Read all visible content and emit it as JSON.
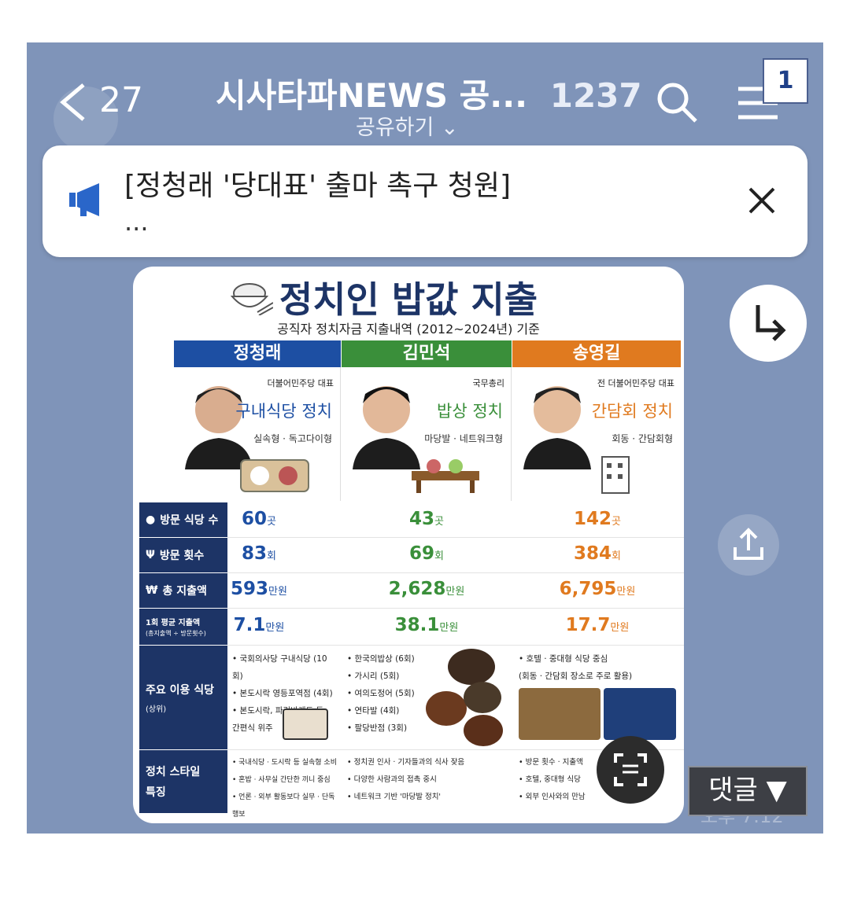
{
  "header": {
    "back_count": "27",
    "chat_title": "시사타파NEWS 공...",
    "member_count": "1237",
    "share_label": "공유하기",
    "badge": "1"
  },
  "notice": {
    "text": "[정청래 '당대표' 출마 촉구 청원]",
    "more": "..."
  },
  "infographic": {
    "title": "정치인 밥값 지출",
    "subtitle": "공직자 정치자금 지출내역 (2012~2024년) 기준",
    "columns": [
      {
        "name": "정청래",
        "party": "더불어민주당 대표",
        "style": "구내식당 정치",
        "type": "실속형 · 독고다이형",
        "color": "#1d4fa3"
      },
      {
        "name": "김민석",
        "party": "국무총리",
        "style": "밥상 정치",
        "type": "마당발 · 네트워크형",
        "color": "#3a8f3a"
      },
      {
        "name": "송영길",
        "party": "전 더불어민주당 대표",
        "style": "간담회 정치",
        "type": "회동 · 간담회형",
        "color": "#e07a1f"
      }
    ],
    "rows": [
      {
        "label": "방문 식당 수",
        "values": [
          "60",
          "43",
          "142"
        ],
        "unit": "곳"
      },
      {
        "label": "방문 횟수",
        "values": [
          "83",
          "69",
          "384"
        ],
        "unit": "회"
      },
      {
        "label": "총 지출액",
        "values": [
          "593",
          "2,628",
          "6,795"
        ],
        "unit": "만원"
      },
      {
        "label": "1회 평균 지출액",
        "values": [
          "7.1",
          "38.1",
          "17.7"
        ],
        "unit": "만원"
      }
    ],
    "avg_note": "(총지출액 ÷ 방문횟수)",
    "main_label": "주요 이용 식당",
    "main_label_sub": "(상위)",
    "main_lists": [
      [
        "• 국회의사당 구내식당 (10회)",
        "• 본도시락 영등포역점 (4회)",
        "• 본도시락, 파리바게트 등",
        "  간편식 위주"
      ],
      [
        "• 한국의밥상 (6회)",
        "• 가시리 (5회)",
        "• 여의도정어 (5회)",
        "• 연타발 (4회)",
        "• 팔당반점 (3회)"
      ],
      [
        "• 호텔 · 중대형 식당 중심",
        "  (회동 · 간담회 장소로 주로 활용)"
      ]
    ],
    "style_label": "정치 스타일",
    "style_label_sub": "특징",
    "style_lists": [
      [
        "• 국내식당 · 도시락 등 실속형 소비",
        "• 혼밥 · 사무실 간단한 끼니 중심",
        "• 언론 · 외부 활동보다 실무 · 단독 행보"
      ],
      [
        "• 정치권 인사 · 기자들과의 식사 잦음",
        "• 다양한 사람과의 접촉 중시",
        "• 네트워크 기반 '마당발 정치'"
      ],
      [
        "• 방문 횟수 · 지출액",
        "• 호텔, 중대형 식당",
        "• 외부 인사와의 만남"
      ]
    ]
  },
  "comment_button": "댓글 ▼",
  "time": "오후 7:12",
  "colors": {
    "background": "#7f94b9",
    "navy": "#1d3466"
  }
}
